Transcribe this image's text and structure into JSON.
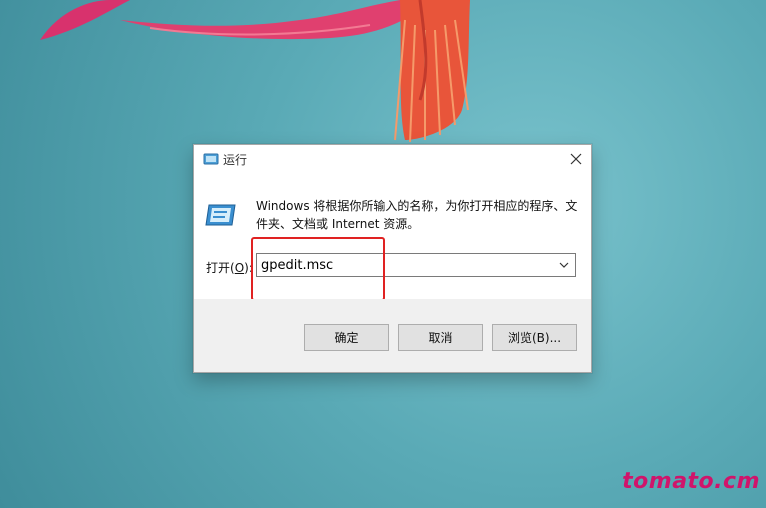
{
  "dialog": {
    "title": "运行",
    "description": "Windows 将根据你所输入的名称，为你打开相应的程序、文件夹、文档或 Internet 资源。",
    "open_label_prefix": "打开(",
    "open_label_accel": "O",
    "open_label_suffix": "):",
    "command_value": "gpedit.msc",
    "buttons": {
      "ok": "确定",
      "cancel": "取消",
      "browse": "浏览(B)..."
    }
  },
  "watermark": "tomato.cm",
  "colors": {
    "highlight": "#e02222",
    "watermark": "#d0146b",
    "desktop": "#5aaab6"
  },
  "icons": [
    "run-title-icon",
    "run-app-icon",
    "close-icon",
    "chevron-down-icon"
  ]
}
